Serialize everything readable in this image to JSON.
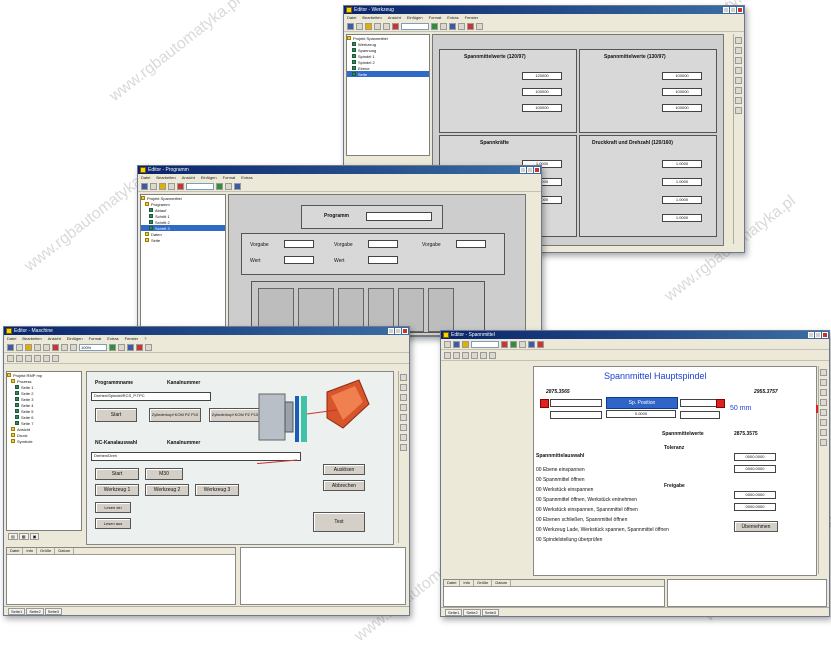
{
  "win1": {
    "title": "Editor - Werkzeug",
    "menu": [
      "Datei",
      "Bearbeiten",
      "Ansicht",
      "Einfügen",
      "Format",
      "Extras",
      "Fenster",
      "?"
    ],
    "tree": [
      "Projekt Spannmittel",
      "Werkzeug",
      "Spannung",
      "Spindel 1",
      "Spindel 2",
      "Ebene",
      "Seite"
    ],
    "table_headers": [
      "Spannmittelwerte (120/97)",
      "Spannmittelwerte (130/97)"
    ],
    "table_section2_headers": [
      "Spannkräfte",
      "Druckkraft und Drehzahl (120/160)"
    ],
    "row_values_left": [
      "120000",
      "100000",
      "100000"
    ],
    "row_values_right": [
      "100000",
      "100000",
      "100000"
    ],
    "row_values_left2": [
      "1.0000",
      "1.0000",
      "1.0000"
    ],
    "row_values_right2": [
      "1.0000",
      "1.0000",
      "1.0000",
      "1.0000"
    ]
  },
  "win2": {
    "title": "Editor - Programm",
    "programm_label": "Programm",
    "fields": [
      "Vorgabe",
      "Vorgabe",
      "Vorgabe",
      "Wert",
      "Wert"
    ],
    "tree": [
      "Projekt Spannmittel",
      "Programm",
      "Ablauf",
      "Schritt 1",
      "Schritt 2",
      "Schritt 3",
      "Daten",
      "Seite"
    ]
  },
  "win3": {
    "title": "Editor - Maschine",
    "zoom": "100%",
    "menu": [
      "Datei",
      "Bearbeiten",
      "Ansicht",
      "Einfügen",
      "Format",
      "Extras",
      "Fenster",
      "?"
    ],
    "tree": [
      "Projekt RMP mp",
      "Prozess",
      "Seite 1",
      "Seite 2",
      "Seite 3",
      "Seite 4",
      "Seite 5",
      "Seite 6",
      "Seite 7",
      "Ansicht",
      "Druck",
      "Symbole"
    ],
    "programmname_label": "Programmname",
    "kanalnummer_label": "Kanalnummer",
    "programm_path": "Drehen/Spindel/RCS_P.TPC",
    "start_label": "Start",
    "zyl1_label": "Zylinderkopf KOM PZ P10",
    "zyl2_label": "Zylinderkopf KOM PZ P10",
    "nc_label": "NC-Kanalauswahl",
    "kanalnummer2_label": "Kanalnummer",
    "nc_path": "Drehen/Dreh",
    "start2_label": "Start",
    "m30_label": "M30",
    "wz1": "Werkzeug 1",
    "wz2": "Werkzeug 2",
    "wz3": "Werkzeug 3",
    "wz4": "Lesen ein",
    "wz5": "Lesen aus",
    "ausl_label": "Auslösen",
    "abbr_label": "Abbrechen",
    "test_label": "Test",
    "status_tabs": [
      "Seite1",
      "Seite2",
      "Seite3"
    ],
    "grid_headers": [
      "Datei",
      "Info",
      "Größe",
      "Datum"
    ]
  },
  "win4": {
    "title": "Editor - Spannmittel",
    "heading": "Spannmittel Hauptspindel",
    "spann_from": "2875.3565",
    "spann_to": "2955.3757",
    "status": "Sp. Position",
    "value_label": "50 mm",
    "value_mini1": "0.0000",
    "sp_label": "Spannmittelwerte",
    "sp_value": "2875.3575",
    "toleranz_label": "Toleranz",
    "toleranz_values": [
      "0000.0000",
      "0000.0000"
    ],
    "list_title": "Spannmittelauswahl",
    "list_items": [
      "00 Ebene einspannen",
      "00 Spannmittel öffnen",
      "00 Werkstück einspannen",
      "00 Spannmittel öffnen, Werkstück entnehmen",
      "00 Werkstück einspannen, Spannmittel öffnen",
      "00 Ebenen schließen, Spannmittel öffnen",
      "00 Werkzeug Lade, Werkstück spannen, Spannmittel öffnen",
      "00 Spindelstellung überprüfen"
    ],
    "preisgabe_label": "Freigabe",
    "preisgabe_values": [
      "0000.0000",
      "0000.0000"
    ],
    "uber_label": "Übernehmen",
    "status_tabs": [
      "Seite1",
      "Seite2",
      "Seite3"
    ],
    "grid_headers": [
      "Datei",
      "Info",
      "Größe",
      "Datum"
    ]
  },
  "watermark": "www.rgbautomatyka.pl"
}
